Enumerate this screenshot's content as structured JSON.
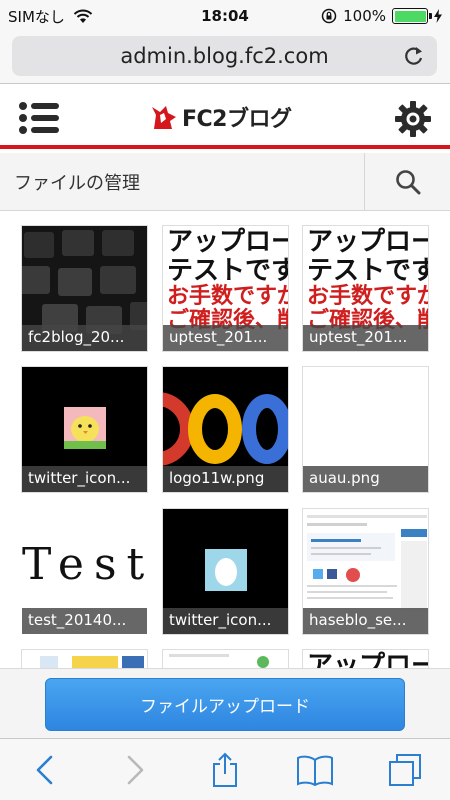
{
  "status_bar": {
    "carrier": "SIMなし",
    "time": "18:04",
    "battery_percent": "100%",
    "battery_level": 1.0,
    "battery_color": "#4cd964"
  },
  "browser": {
    "url": "admin.blog.fc2.com",
    "reload_icon": "reload-icon"
  },
  "header": {
    "logo_text": "FC2ブログ",
    "accent_color": "#d5161c",
    "menu_icon": "list-menu-icon",
    "settings_icon": "gear-icon"
  },
  "page": {
    "title": "ファイルの管理",
    "search_icon": "search-icon"
  },
  "files": [
    {
      "name": "fc2blog_20...",
      "thumb": "keyboard"
    },
    {
      "name": "uptest_201...",
      "thumb": "text"
    },
    {
      "name": "uptest_201...",
      "thumb": "text"
    },
    {
      "name": "twitter_icon...",
      "thumb": "chick"
    },
    {
      "name": "logo11w.png",
      "thumb": "google"
    },
    {
      "name": "auau.png",
      "thumb": "blank"
    },
    {
      "name": "test_20140...",
      "thumb": "handwriting"
    },
    {
      "name": "twitter_icon...",
      "thumb": "egg"
    },
    {
      "name": "haseblo_se...",
      "thumb": "screenshot"
    }
  ],
  "thumb_text": {
    "line1": "アップロード",
    "line2": "テストです。",
    "line3": "お手数ですが",
    "line4": "ご確認後、削除"
  },
  "handwriting_text": "Test",
  "upload_button": {
    "label": "ファイルアップロード",
    "color": "#2e86e0"
  },
  "toolbar": {
    "items": [
      "back-icon",
      "forward-icon",
      "share-icon",
      "bookmarks-icon",
      "tabs-icon"
    ],
    "tint": "#2a7fd0"
  }
}
